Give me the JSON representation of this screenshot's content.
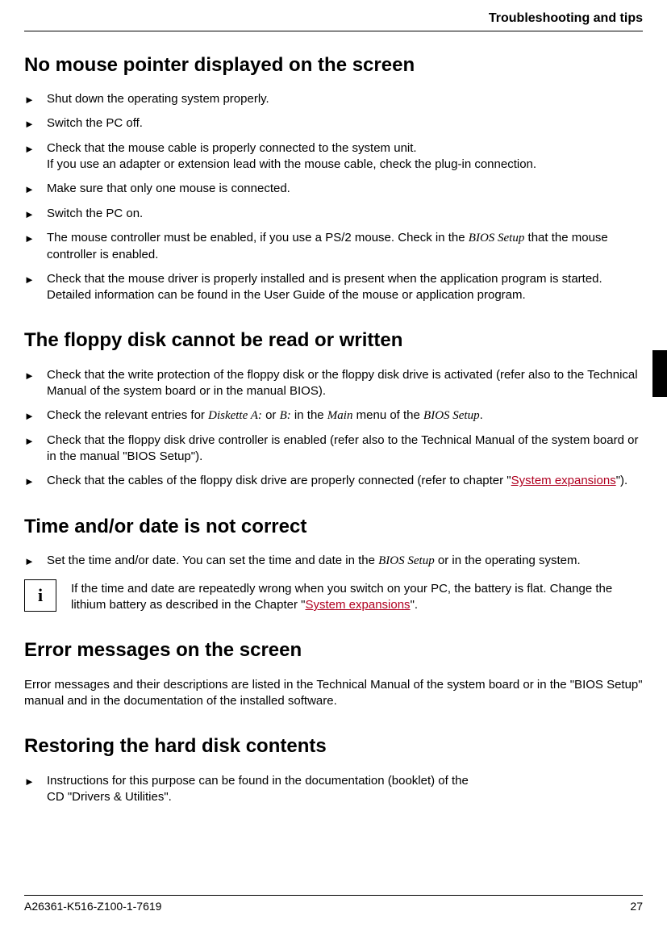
{
  "header": {
    "title": "Troubleshooting and tips"
  },
  "sections": {
    "mouse": {
      "heading": "No mouse pointer displayed on the screen",
      "items": {
        "i0": "Shut down the operating system properly.",
        "i1": "Switch the PC off.",
        "i2a": "Check that the mouse cable is properly connected to the system unit.",
        "i2b": "If you use an adapter or extension lead with the mouse cable, check the plug-in connection.",
        "i3": "Make sure that only one mouse is connected.",
        "i4": "Switch the PC on.",
        "i5a": "The mouse controller must be enabled, if you use a PS/2 mouse. Check in the ",
        "i5b": "BIOS Setup",
        "i5c": " that the mouse controller is enabled.",
        "i6": "Check that the mouse driver is properly installed and is present when the application program is started. Detailed information can be found in the User Guide of the mouse or application program."
      }
    },
    "floppy": {
      "heading": "The floppy disk cannot be read or written",
      "items": {
        "i0": "Check that the write protection of the floppy disk or the floppy disk drive is activated (refer also to the Technical Manual of the system board or in the manual BIOS).",
        "i1a": "Check the relevant entries for ",
        "i1b": "Diskette A:",
        "i1c": " or ",
        "i1d": "B:",
        "i1e": " in the ",
        "i1f": "Main",
        "i1g": " menu of the ",
        "i1h": "BIOS Setup",
        "i1i": ".",
        "i2": "Check that the floppy disk drive controller is enabled (refer also to the Technical Manual of the system board or in the manual \"BIOS Setup\").",
        "i3a": "Check that the cables of the floppy disk drive are properly connected (refer to chapter \"",
        "i3b": "System expansions",
        "i3c": "\")."
      }
    },
    "time": {
      "heading": "Time and/or date is not correct",
      "items": {
        "i0a": "Set the time and/or date. You can set the time and date in the ",
        "i0b": "BIOS Setup",
        "i0c": " or in the operating system."
      },
      "info": {
        "icon": "i",
        "text_a": "If the time and date are repeatedly wrong when you switch on your PC, the battery is flat. Change the lithium battery as described in the Chapter \"",
        "text_b": "System expansions",
        "text_c": "\"."
      }
    },
    "errors": {
      "heading": "Error messages on the screen",
      "body": "Error messages and their descriptions are listed in the Technical Manual of the system board or in the \"BIOS Setup\" manual and in the documentation of the installed software."
    },
    "restore": {
      "heading": "Restoring the hard disk contents",
      "items": {
        "i0a": "Instructions for this purpose can be found in the documentation (booklet) of the",
        "i0b": "CD \"Drivers & Utilities\"."
      }
    }
  },
  "footer": {
    "doc_id": "A26361-K516-Z100-1-7619",
    "page_num": "27"
  },
  "bullet_glyph": "►"
}
